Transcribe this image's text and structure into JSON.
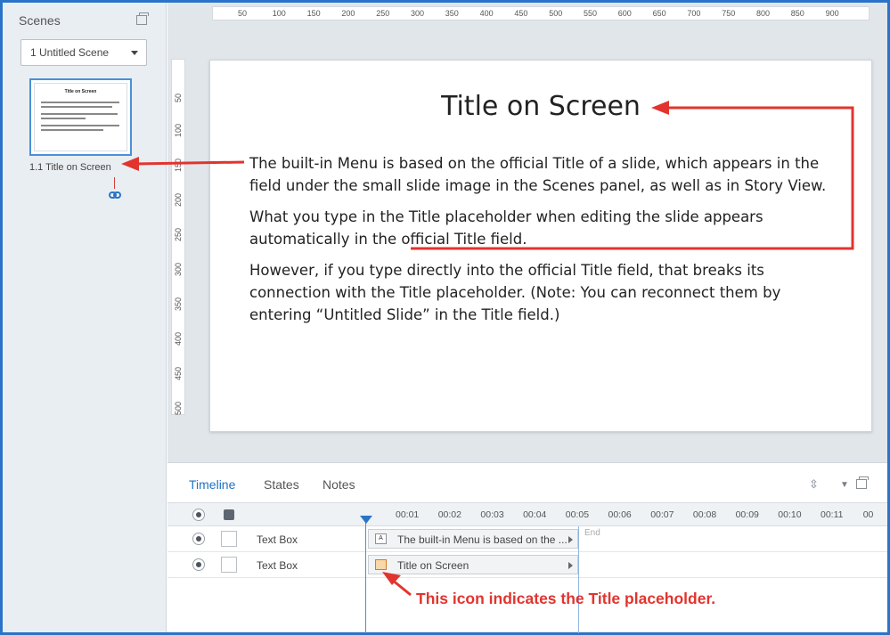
{
  "scenes": {
    "panel_title": "Scenes",
    "dropdown_value": "1 Untitled Scene",
    "thumb_label": "1.1 Title on Screen",
    "thumb_title": "Title on Screen"
  },
  "ruler": {
    "h_ticks": [
      "50",
      "100",
      "150",
      "200",
      "250",
      "300",
      "350",
      "400",
      "450",
      "500",
      "550",
      "600",
      "650",
      "700",
      "750",
      "800",
      "850",
      "900"
    ],
    "v_ticks": [
      "50",
      "100",
      "150",
      "200",
      "250",
      "300",
      "350",
      "400",
      "450",
      "500"
    ]
  },
  "slide": {
    "title": "Title on Screen",
    "paragraphs": [
      "The built-in Menu is based on the official Title of a slide, which appears in the field under the small slide image in the Scenes panel, as well as in Story View.",
      "What you type in the Title placeholder when editing the slide appears automatically in the official Title field.",
      "However, if you type directly into the official Title field, that breaks its connection with the Title placeholder. (Note: You can reconnect them by entering “Untitled Slide” in the Title field.)"
    ]
  },
  "timeline": {
    "tabs": [
      "Timeline",
      "States",
      "Notes"
    ],
    "time_labels": [
      "00:01",
      "00:02",
      "00:03",
      "00:04",
      "00:05",
      "00:06",
      "00:07",
      "00:08",
      "00:09",
      "00:10",
      "00:11",
      "00"
    ],
    "end_label": "End",
    "rows": [
      {
        "name": "Text Box",
        "bar_text": "The built-in Menu is based on the ...",
        "icon": "text-box-icon",
        "icon_glyph": "A"
      },
      {
        "name": "Text Box",
        "bar_text": "Title on Screen",
        "icon": "title-placeholder-icon",
        "icon_glyph": ""
      }
    ]
  },
  "annotation": "This icon indicates the Title placeholder.",
  "colors": {
    "accent": "#1f73c4",
    "annotation": "#e2342e",
    "frame": "#2a73c8"
  }
}
